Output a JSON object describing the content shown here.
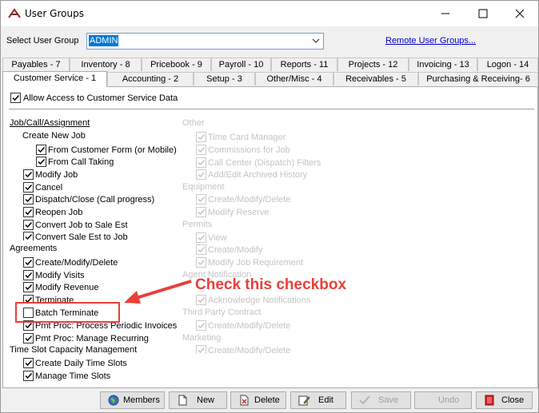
{
  "window": {
    "title": "User Groups"
  },
  "select_group": {
    "label": "Select User Group",
    "value": "ADMIN"
  },
  "remote_link": "Remote User Groups...",
  "tabs_row1": [
    "Payables - 7",
    "Inventory - 8",
    "Pricebook - 9",
    "Payroll - 10",
    "Reports - 11",
    "Projects - 12",
    "Invoicing - 13",
    "Logon - 14"
  ],
  "tabs_row2": [
    "Customer Service - 1",
    "Accounting - 2",
    "Setup - 3",
    "Other/Misc - 4",
    "Receivables - 5",
    "Purchasing & Receiving- 6"
  ],
  "allow_access": "Allow Access to Customer Service Data",
  "left": {
    "job_header": "Job/Call/Assignment",
    "create_new_job": "Create New Job",
    "from_customer_form": "From Customer Form (or Mobile)",
    "from_call_taking": "From Call Taking",
    "modify_job": "Modify Job",
    "cancel": "Cancel",
    "dispatch_close": "Dispatch/Close (Call progress)",
    "reopen_job": "Reopen Job",
    "convert_job": "Convert Job to Sale Est",
    "convert_sale": "Convert Sale Est to Job",
    "agreements_header": "Agreements",
    "create_modify_delete": "Create/Modify/Delete",
    "modify_visits": "Modify Visits",
    "modify_revenue": "Modify Revenue",
    "terminate": "Terminate",
    "batch_terminate": "Batch Terminate",
    "pmt_periodic": "Pmt Proc: Process Periodic Invoices",
    "pmt_recurring": "Pmt Proc: Manage Recurring",
    "timeslot_header": "Time Slot Capacity Management",
    "create_daily": "Create Daily Time Slots",
    "manage_slots": "Manage Time Slots"
  },
  "right": {
    "other_header": "Other",
    "time_card": "Time Card Manager",
    "commissions": "Commissions for Job",
    "call_center": "Call Center (Dispatch) Filters",
    "add_edit_archived": "Add/Edit Archived History",
    "equipment_header": "Equipment",
    "eq_cmd": "Create/Modify/Delete",
    "modify_reserve": "Modify Reserve",
    "permits_header": "Permits",
    "view": "View",
    "create_modify": "Create/Modify",
    "modify_job_req": "Modify Job Requirement",
    "agent_header": "Agent Notification",
    "ack_notifications": "Acknowledge Notifications",
    "third_party_header": "Third Party Contract",
    "tp_cmd": "Create/Modify/Delete",
    "marketing_header": "Marketing",
    "mk_cmd": "Create/Modify/Delete"
  },
  "annotation": "Check this checkbox",
  "buttons": {
    "members": "Members",
    "new": "New",
    "delete": "Delete",
    "edit": "Edit",
    "save": "Save",
    "undo": "Undo",
    "close": "Close"
  },
  "colors": {
    "annotation": "#e8403a",
    "selection": "#0078d7",
    "link": "#0000cc"
  }
}
